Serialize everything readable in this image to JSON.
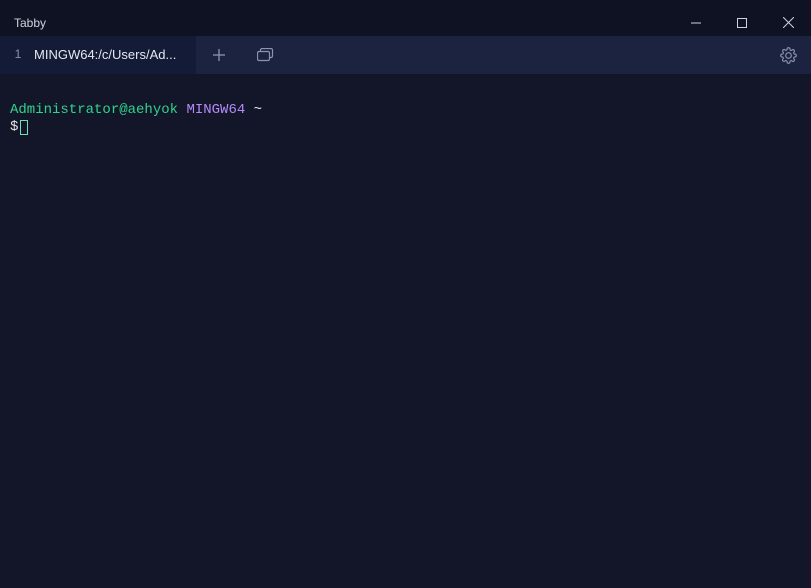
{
  "app": {
    "title": "Tabby"
  },
  "tabs": {
    "items": [
      {
        "index": "1",
        "title": "MINGW64:/c/Users/Ad..."
      }
    ]
  },
  "terminal": {
    "user_host": "Administrator@aehyok",
    "shell": "MINGW64",
    "path": "~",
    "prompt": "$"
  }
}
